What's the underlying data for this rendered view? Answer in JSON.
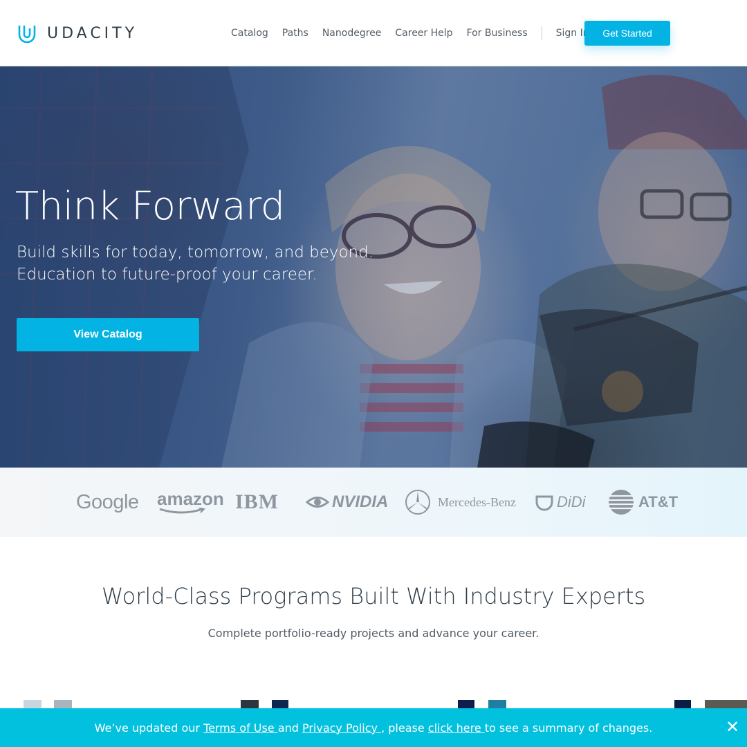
{
  "header": {
    "brand": "UDACITY",
    "nav": [
      "Catalog",
      "Paths",
      "Nanodegree",
      "Career Help",
      "For Business"
    ],
    "sign_in": "Sign In",
    "get_started": "Get Started"
  },
  "hero": {
    "title": "Think Forward",
    "subtitle_line1": "Build skills for today, tomorrow, and beyond.",
    "subtitle_line2": "Education to future-proof your career.",
    "cta": "View Catalog"
  },
  "partners": {
    "google": "Google",
    "amazon": "amazon",
    "ibm": "IBM",
    "nvidia": "NVIDIA",
    "mercedes": "Mercedes-Benz",
    "didi": "DiDi",
    "att": "AT&T"
  },
  "programs": {
    "title": "World-Class Programs Built With Industry Experts",
    "subtitle": "Complete portfolio-ready projects and advance your career."
  },
  "banner": {
    "prefix": "We’ve updated our ",
    "terms": "Terms of Use ",
    "and": "and ",
    "privacy": "Privacy Policy ",
    "middle": ", please ",
    "click_here": "click here ",
    "suffix": "to see a summary of changes."
  },
  "colors": {
    "accent": "#02b3e4",
    "banner": "#02c1df",
    "text": "#2e3d49"
  }
}
